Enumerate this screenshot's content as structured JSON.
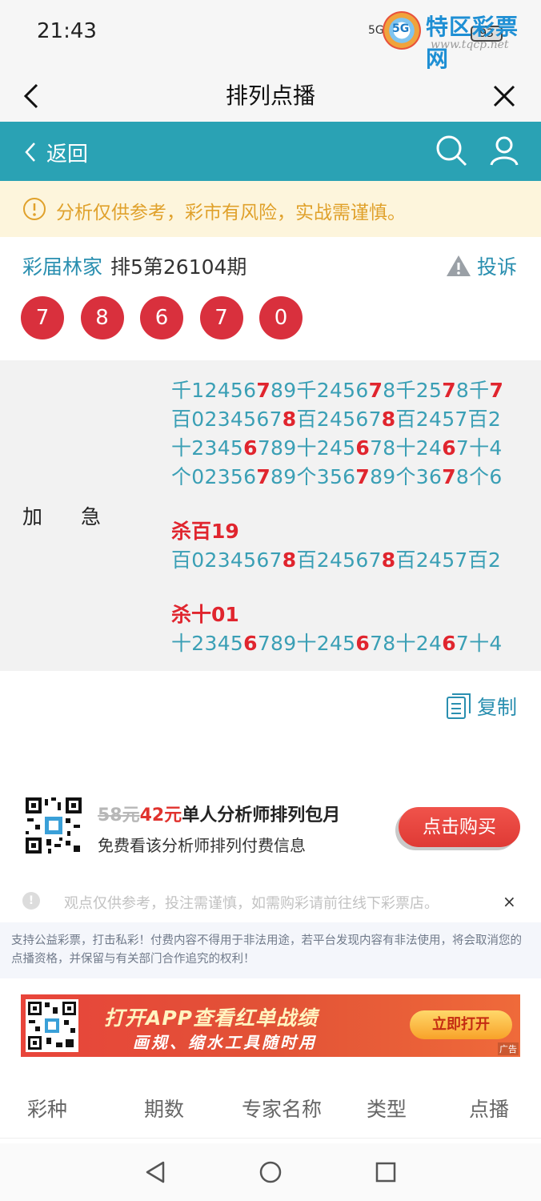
{
  "status_bar": {
    "time": "21:43",
    "signal": "5G",
    "battery": "93"
  },
  "watermark": {
    "logo_text": "5G",
    "title": "特区彩票网",
    "url": "www.tqcp.net"
  },
  "title_bar": {
    "title": "排列点播"
  },
  "nav_bar": {
    "back_label": "返回"
  },
  "notice": {
    "text": "分析仅供参考，彩市有风险，实战需谨慎。"
  },
  "header": {
    "expert_name": "彩届林家",
    "issue": "排5第26104期",
    "complain_label": "投诉"
  },
  "draw_numbers": [
    "7",
    "8",
    "6",
    "7",
    "0"
  ],
  "content": {
    "label": "加急",
    "groups": [
      {
        "title": "",
        "lines": [
          [
            {
              "t": "千12456"
            },
            {
              "t": "7",
              "hl": true
            },
            {
              "t": "89千2456"
            },
            {
              "t": "7",
              "hl": true
            },
            {
              "t": "8千25"
            },
            {
              "t": "7",
              "hl": true
            },
            {
              "t": "8千"
            },
            {
              "t": "7",
              "hl": true
            }
          ],
          [
            {
              "t": "百0234567"
            },
            {
              "t": "8",
              "hl": true
            },
            {
              "t": "百24567"
            },
            {
              "t": "8",
              "hl": true
            },
            {
              "t": "百2457百2"
            }
          ],
          [
            {
              "t": "十2345"
            },
            {
              "t": "6",
              "hl": true
            },
            {
              "t": "789十245"
            },
            {
              "t": "6",
              "hl": true
            },
            {
              "t": "78十24"
            },
            {
              "t": "6",
              "hl": true
            },
            {
              "t": "7十4"
            }
          ],
          [
            {
              "t": "个02356"
            },
            {
              "t": "7",
              "hl": true
            },
            {
              "t": "89个356"
            },
            {
              "t": "7",
              "hl": true
            },
            {
              "t": "89个36"
            },
            {
              "t": "7",
              "hl": true
            },
            {
              "t": "8个6"
            }
          ]
        ]
      },
      {
        "title": "杀百19",
        "lines": [
          [
            {
              "t": "百0234567"
            },
            {
              "t": "8",
              "hl": true
            },
            {
              "t": "百24567"
            },
            {
              "t": "8",
              "hl": true
            },
            {
              "t": "百2457百2"
            }
          ]
        ]
      },
      {
        "title": "杀十01",
        "lines": [
          [
            {
              "t": "十2345"
            },
            {
              "t": "6",
              "hl": true
            },
            {
              "t": "789十245"
            },
            {
              "t": "6",
              "hl": true
            },
            {
              "t": "78十24"
            },
            {
              "t": "6",
              "hl": true
            },
            {
              "t": "7十4"
            }
          ]
        ]
      }
    ]
  },
  "copy_label": "复制",
  "promo": {
    "old_price": "58元",
    "new_price": "42元",
    "title": "单人分析师排列包月",
    "subtitle": "免费看该分析师排列付费信息",
    "buy_label": "点击购买"
  },
  "disclaimer": {
    "text": "观点仅供参考，投注需谨慎，如需购彩请前往线下彩票店。",
    "close": "×"
  },
  "terms": "支持公益彩票，打击私彩！付费内容不得用于非法用途，若平台发现内容有非法使用，将会取消您的点播资格，并保留与有关部门合作追究的权利！",
  "banner": {
    "line1": "打开APP查看红单战绩",
    "line2": "画规、缩水工具随时用",
    "button": "立即打开",
    "ad_tag": "广告"
  },
  "table_header": [
    "彩种",
    "期数",
    "专家名称",
    "类型",
    "点播"
  ],
  "colors": {
    "teal": "#2aa2b4",
    "red": "#d9303d",
    "highlight": "#e0252e",
    "number_text": "#3a9fb5",
    "notice_bg": "#fdf5dc"
  }
}
